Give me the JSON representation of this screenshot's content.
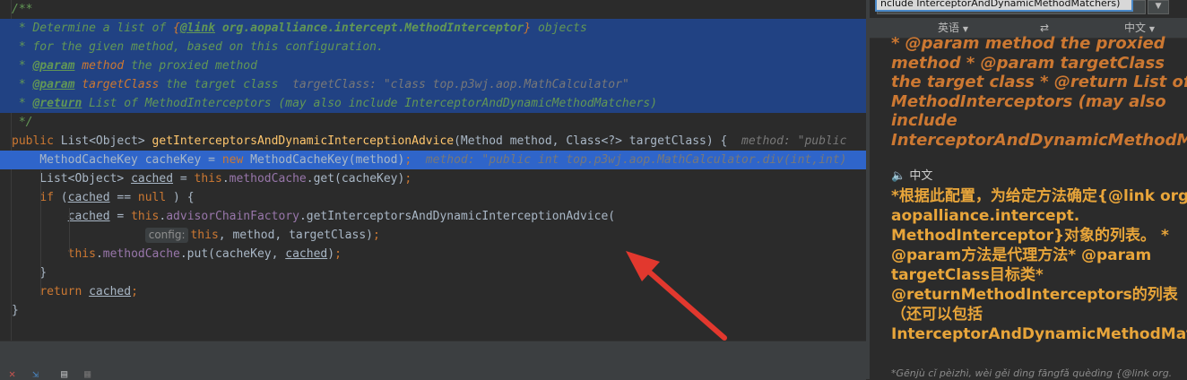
{
  "editor": {
    "lines": [
      {
        "segs": [
          [
            "c-doc",
            "/**"
          ]
        ]
      },
      {
        "segs": [
          [
            "c-doc",
            " * Determine a list of "
          ],
          [
            "c-brace",
            "{"
          ],
          [
            "c-tag",
            "@link"
          ],
          [
            "c-doc",
            " "
          ],
          [
            "c-docb",
            "org.aopalliance.intercept.MethodInterceptor"
          ],
          [
            "c-brace",
            "}"
          ],
          [
            "c-doc",
            " objects"
          ]
        ]
      },
      {
        "segs": [
          [
            "c-doc",
            " * for the given method, based on this configuration."
          ]
        ]
      },
      {
        "segs": [
          [
            "c-doc",
            " * "
          ],
          [
            "c-tag",
            "@param"
          ],
          [
            "c-doc",
            " "
          ],
          [
            "c-kwi",
            "method"
          ],
          [
            "c-doc",
            " the proxied method"
          ]
        ]
      },
      {
        "segs": [
          [
            "c-doc",
            " * "
          ],
          [
            "c-tag",
            "@param"
          ],
          [
            "c-doc",
            " "
          ],
          [
            "c-kwi",
            "targetClass"
          ],
          [
            "c-doc",
            " the target class  "
          ],
          [
            "c-hint",
            "targetClass: \"class top.p3wj.aop.MathCalculator\""
          ]
        ]
      },
      {
        "segs": [
          [
            "c-doc",
            " * "
          ],
          [
            "c-tag",
            "@return"
          ],
          [
            "c-doc",
            " List of MethodInterceptors (may also include InterceptorAndDynamicMethodMatchers)"
          ]
        ]
      },
      {
        "segs": [
          [
            "c-doc",
            " */"
          ]
        ]
      },
      {
        "segs": [
          [
            "c-kw",
            "public "
          ],
          [
            "",
            "List<Object> "
          ],
          [
            "c-fn",
            "getInterceptorsAndDynamicInterceptionAdvice"
          ],
          [
            "",
            "(Method method, Class<?> targetClass) "
          ],
          [
            "",
            "{  "
          ],
          [
            "c-hint",
            "method: \"public"
          ]
        ]
      },
      {
        "segs": [
          [
            "",
            "    MethodCacheKey cacheKey = "
          ],
          [
            "c-kw",
            "new "
          ],
          [
            "",
            "MethodCacheKey(method)"
          ],
          [
            "c-kw",
            ";  "
          ],
          [
            "c-hint",
            "method: \"public int top.p3wj.aop.MathCalculator.div(int,int)"
          ]
        ]
      },
      {
        "segs": [
          [
            "",
            "    List<Object> "
          ],
          [
            "c-u",
            "cached"
          ],
          [
            "",
            " = "
          ],
          [
            "c-kw",
            "this"
          ],
          [
            "",
            "."
          ],
          [
            "c-field",
            "methodCache"
          ],
          [
            "",
            ".get(cacheKey)"
          ],
          [
            "c-kw",
            ";"
          ]
        ]
      },
      {
        "segs": [
          [
            "",
            "    "
          ],
          [
            "c-kw",
            "if "
          ],
          [
            "",
            "("
          ],
          [
            "c-u",
            "cached"
          ],
          [
            "",
            " == "
          ],
          [
            "c-kw",
            "null"
          ],
          [
            "",
            " ) {"
          ]
        ]
      },
      {
        "segs": [
          [
            "",
            "        "
          ],
          [
            "c-u",
            "cached"
          ],
          [
            "",
            " = "
          ],
          [
            "c-kw",
            "this"
          ],
          [
            "",
            "."
          ],
          [
            "c-field",
            "advisorChainFactory"
          ],
          [
            "",
            ".getInterceptorsAndDynamicInterceptionAdvice("
          ]
        ]
      },
      {
        "segs": [
          [
            "",
            "                   "
          ],
          [
            "param",
            "config:"
          ],
          [
            "c-kw",
            "this"
          ],
          [
            "",
            ", method, targetClass)"
          ],
          [
            "c-kw",
            ";"
          ]
        ]
      },
      {
        "segs": [
          [
            "",
            "        "
          ],
          [
            "c-kw",
            "this"
          ],
          [
            "",
            "."
          ],
          [
            "c-field",
            "methodCache"
          ],
          [
            "",
            ".put(cacheKey, "
          ],
          [
            "c-u",
            "cached"
          ],
          [
            "",
            ")"
          ],
          [
            "c-kw",
            ";"
          ]
        ]
      },
      {
        "segs": [
          [
            "",
            "    }"
          ]
        ]
      },
      {
        "segs": [
          [
            "",
            "    "
          ],
          [
            "c-kw",
            "return "
          ],
          [
            "c-u",
            "cached"
          ],
          [
            "c-kw",
            ";"
          ]
        ]
      },
      {
        "segs": [
          [
            "",
            "}"
          ]
        ]
      },
      {
        "segs": [
          [
            "",
            ""
          ]
        ]
      },
      {
        "segs": [
          [
            "c-doc",
            "/**"
          ]
        ]
      }
    ]
  },
  "bottombar": {
    "icons": [
      "rerun-icon",
      "step-icon",
      "table-icon",
      "grid-icon"
    ]
  },
  "translator": {
    "input_value": "nclude InterceptorAndDynamicMethodMatchers)",
    "source_lang": "英语",
    "swap_symbol": "⇄",
    "target_lang": "中文",
    "source_text": "* @param method the proxied method * @param targetClass the target class * @return List of MethodInterceptors (may also include InterceptorAndDynamicMethodMatchers)",
    "target_label": "中文",
    "target_text": "*根据此配置，为给定方法确定{@link org. aopalliance.intercept. MethodInterceptor}对象的列表。 * @param方法是代理方法* @param targetClass目标类* @returnMethodInterceptors的列表（还可以包括 InterceptorAndDynamicMethodMatchers)",
    "pinyin_text": "*Gēnjù cǐ pèizhì, wèi gěi dìng fāngfǎ quèdìng {@link org."
  },
  "colors": {
    "selection": "#214283",
    "current_line": "#2f65ca",
    "arrow": "#e2382e",
    "translation": "#e8a53a"
  }
}
